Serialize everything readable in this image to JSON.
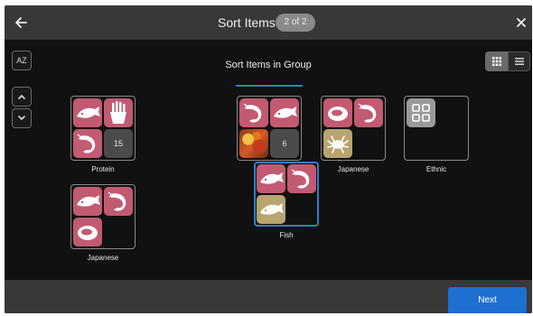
{
  "header": {
    "back_icon": "arrow-left-icon",
    "title": "Sort Items",
    "step_badge": "2 of 2",
    "close_icon": "close-icon"
  },
  "toolbar": {
    "sort_az_label": "AZ",
    "move_up_icon": "chevron-up-icon",
    "move_down_icon": "chevron-down-icon",
    "view_grid_icon": "grid-view-icon",
    "view_list_icon": "list-view-icon"
  },
  "main": {
    "title": "Sort Items in  Group"
  },
  "groups": [
    {
      "name": "Protein",
      "overflow_count": "15"
    },
    {
      "name": "Japanese"
    },
    {
      "name": "",
      "overflow_count": "6"
    },
    {
      "name": "Fish"
    },
    {
      "name": "Japanese"
    },
    {
      "name": "Ethnic"
    }
  ],
  "footer": {
    "next_label": "Next"
  },
  "colors": {
    "accent": "#1f6fd0",
    "tile_pink": "#c25a72",
    "tile_tan": "#b8a46e",
    "header_bg": "#383838",
    "canvas_bg": "#111111"
  }
}
